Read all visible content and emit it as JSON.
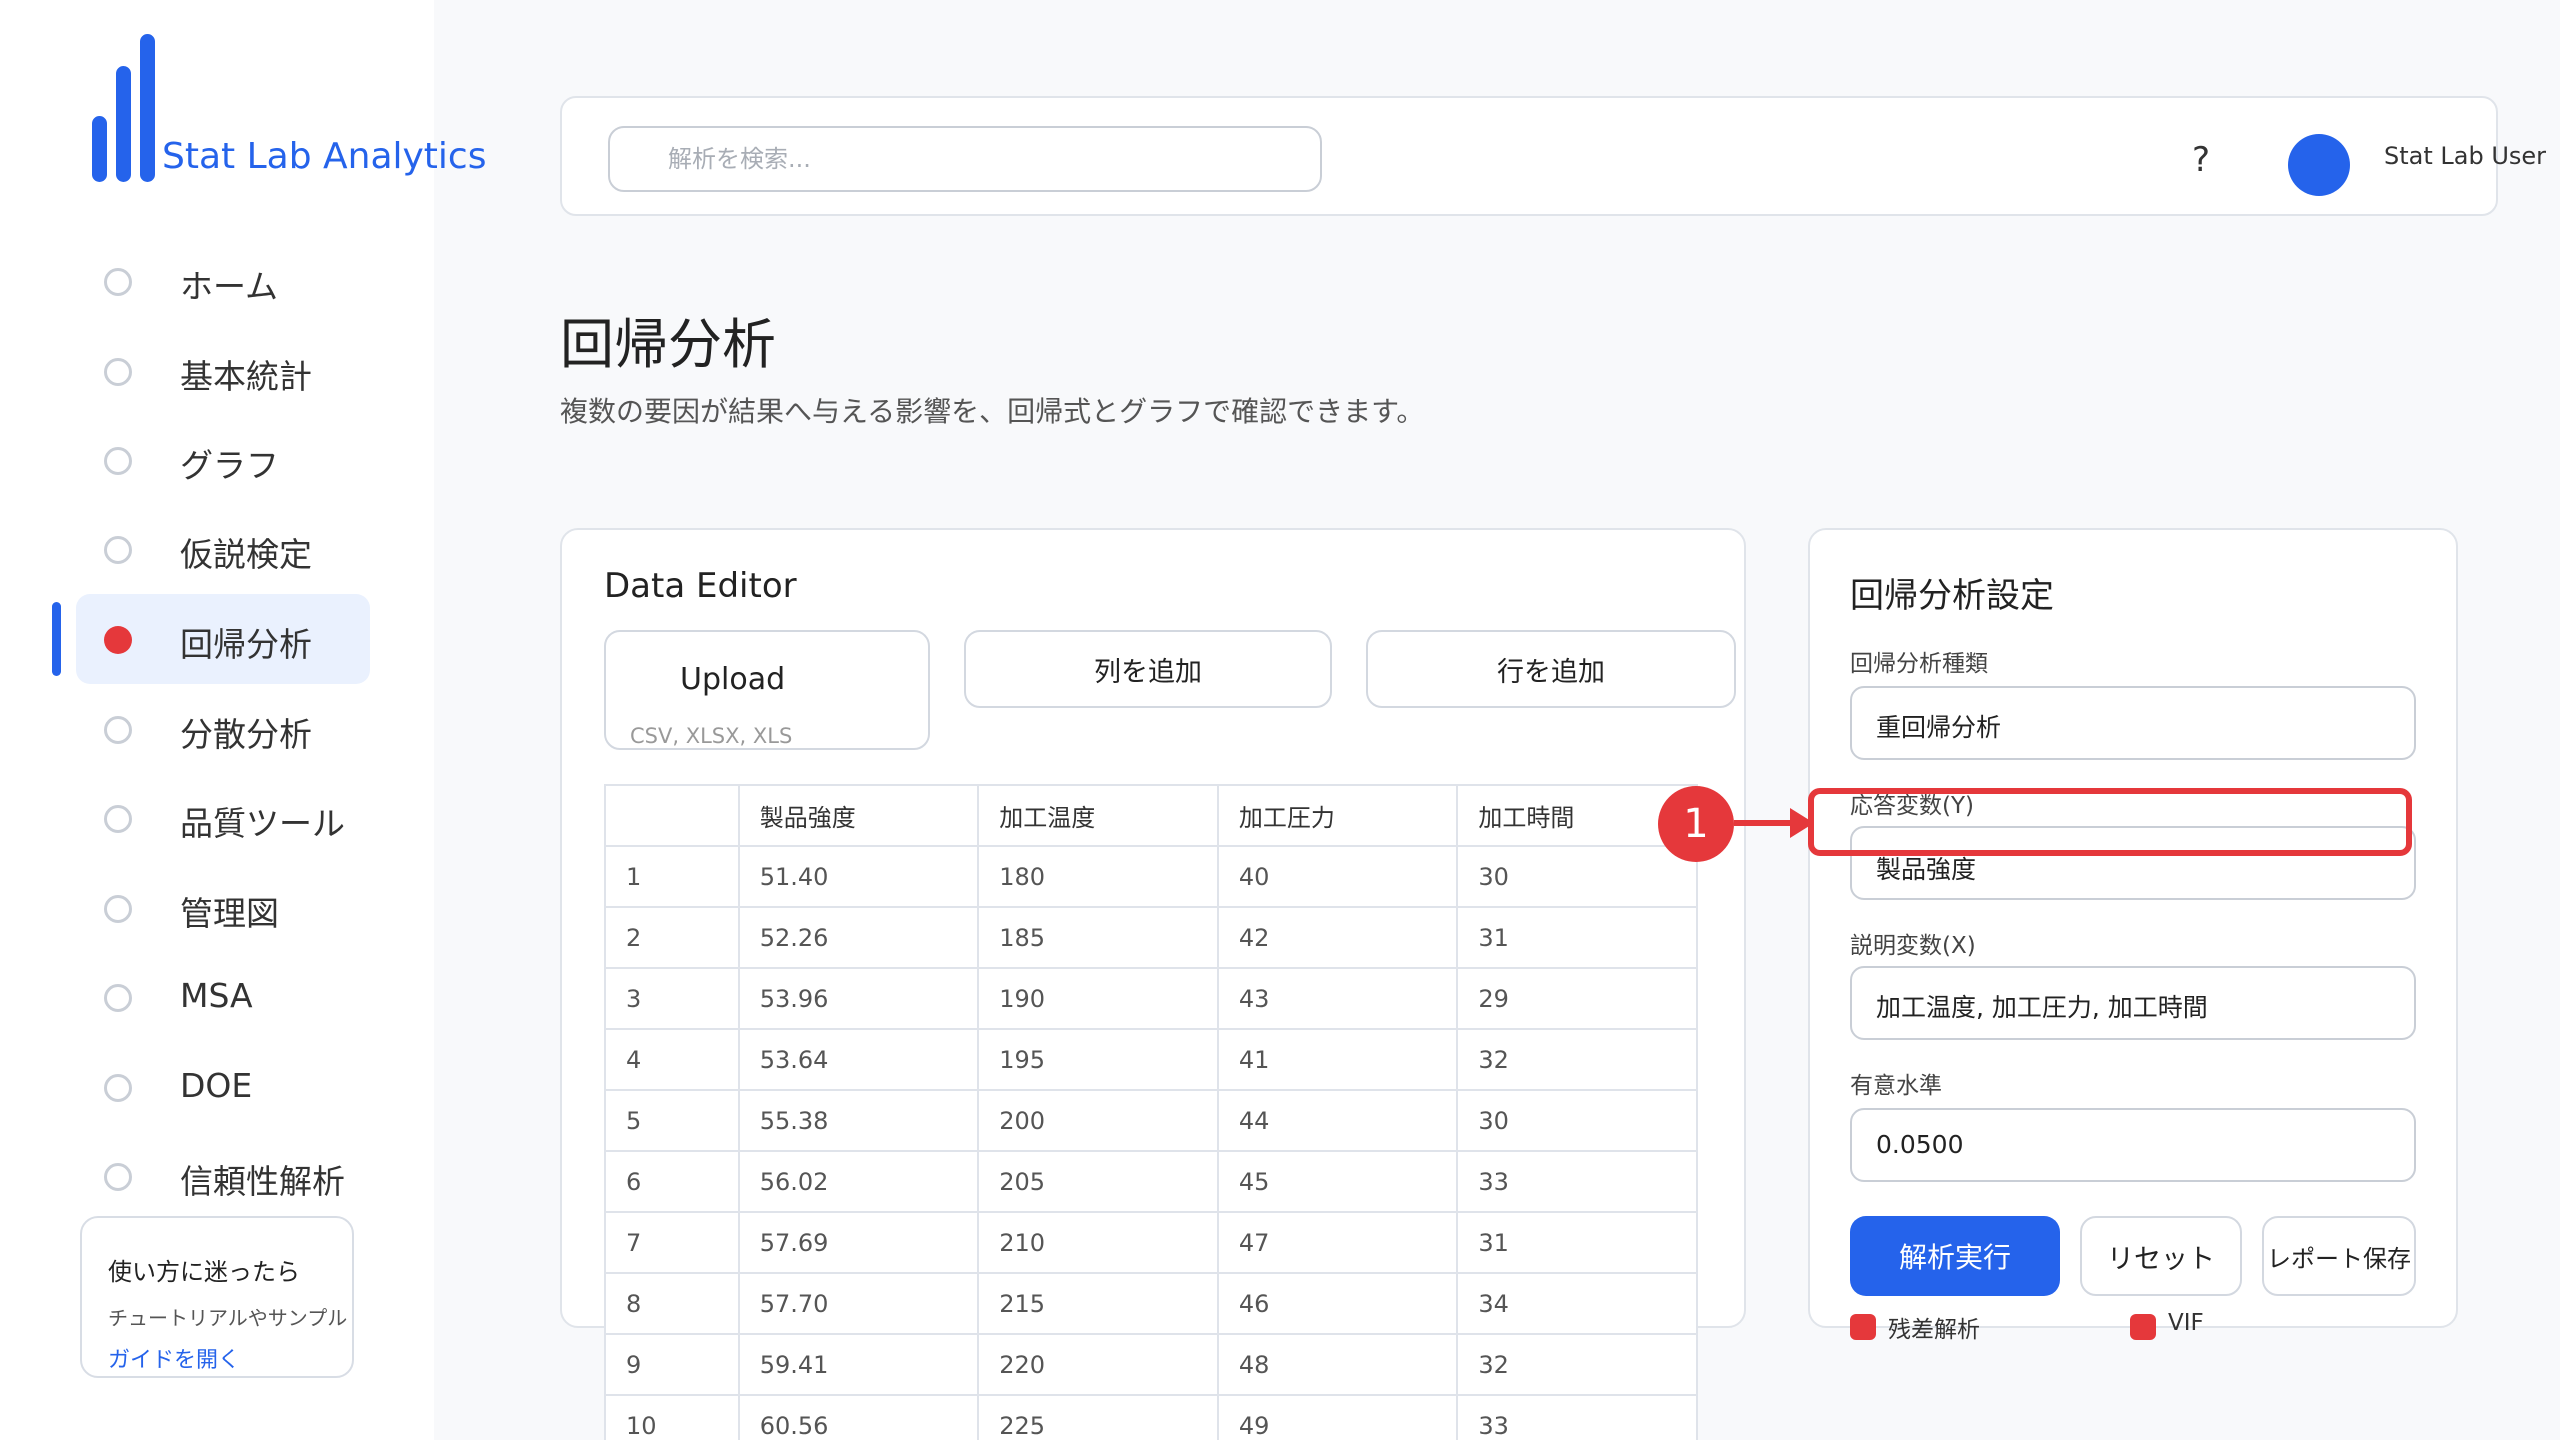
{
  "app": {
    "name": "Stat Lab Analytics",
    "brand_color": "#2563eb",
    "accent_color": "#e5383b"
  },
  "sidebar": {
    "items": [
      {
        "label": "ホーム",
        "active": false
      },
      {
        "label": "基本統計",
        "active": false
      },
      {
        "label": "グラフ",
        "active": false
      },
      {
        "label": "仮説検定",
        "active": false
      },
      {
        "label": "回帰分析",
        "active": true
      },
      {
        "label": "分散分析",
        "active": false
      },
      {
        "label": "品質ツール",
        "active": false
      },
      {
        "label": "管理図",
        "active": false
      },
      {
        "label": "MSA",
        "active": false
      },
      {
        "label": "DOE",
        "active": false
      },
      {
        "label": "信頼性解析",
        "active": false
      }
    ],
    "help": {
      "title": "使い方に迷ったら",
      "description": "チュートリアルやサンプル",
      "link": "ガイドを開く"
    }
  },
  "header": {
    "search_placeholder": "解析を検索...",
    "help_label": "?",
    "user_name": "Stat Lab User"
  },
  "page": {
    "title": "回帰分析",
    "subtitle": "複数の要因が結果へ与える影響を、回帰式とグラフで確認できます。"
  },
  "data_editor": {
    "title": "Data Editor",
    "upload_label": "Upload",
    "upload_hint": "CSV, XLSX, XLS",
    "add_column_label": "列を追加",
    "add_row_label": "行を追加",
    "columns": [
      "",
      "製品強度",
      "加工温度",
      "加工圧力",
      "加工時間"
    ],
    "rows": [
      [
        "1",
        "51.40",
        "180",
        "40",
        "30"
      ],
      [
        "2",
        "52.26",
        "185",
        "42",
        "31"
      ],
      [
        "3",
        "53.96",
        "190",
        "43",
        "29"
      ],
      [
        "4",
        "53.64",
        "195",
        "41",
        "32"
      ],
      [
        "5",
        "55.38",
        "200",
        "44",
        "30"
      ],
      [
        "6",
        "56.02",
        "205",
        "45",
        "33"
      ],
      [
        "7",
        "57.69",
        "210",
        "47",
        "31"
      ],
      [
        "8",
        "57.70",
        "215",
        "46",
        "34"
      ],
      [
        "9",
        "59.41",
        "220",
        "48",
        "32"
      ],
      [
        "10",
        "60.56",
        "225",
        "49",
        "33"
      ]
    ]
  },
  "settings": {
    "title": "回帰分析設定",
    "regression_type": {
      "label": "回帰分析種類",
      "value": "重回帰分析"
    },
    "response": {
      "label": "応答変数(Y)",
      "value": "製品強度"
    },
    "predictors": {
      "label": "説明変数(X)",
      "value": "加工温度, 加工圧力, 加工時間"
    },
    "alpha": {
      "label": "有意水準",
      "value": "0.0500"
    },
    "run_label": "解析実行",
    "reset_label": "リセット",
    "save_label": "レポート保存",
    "options": [
      {
        "label": "残差解析",
        "checked": true
      },
      {
        "label": "VIF",
        "checked": true
      }
    ]
  },
  "annotation": {
    "label": "1"
  }
}
